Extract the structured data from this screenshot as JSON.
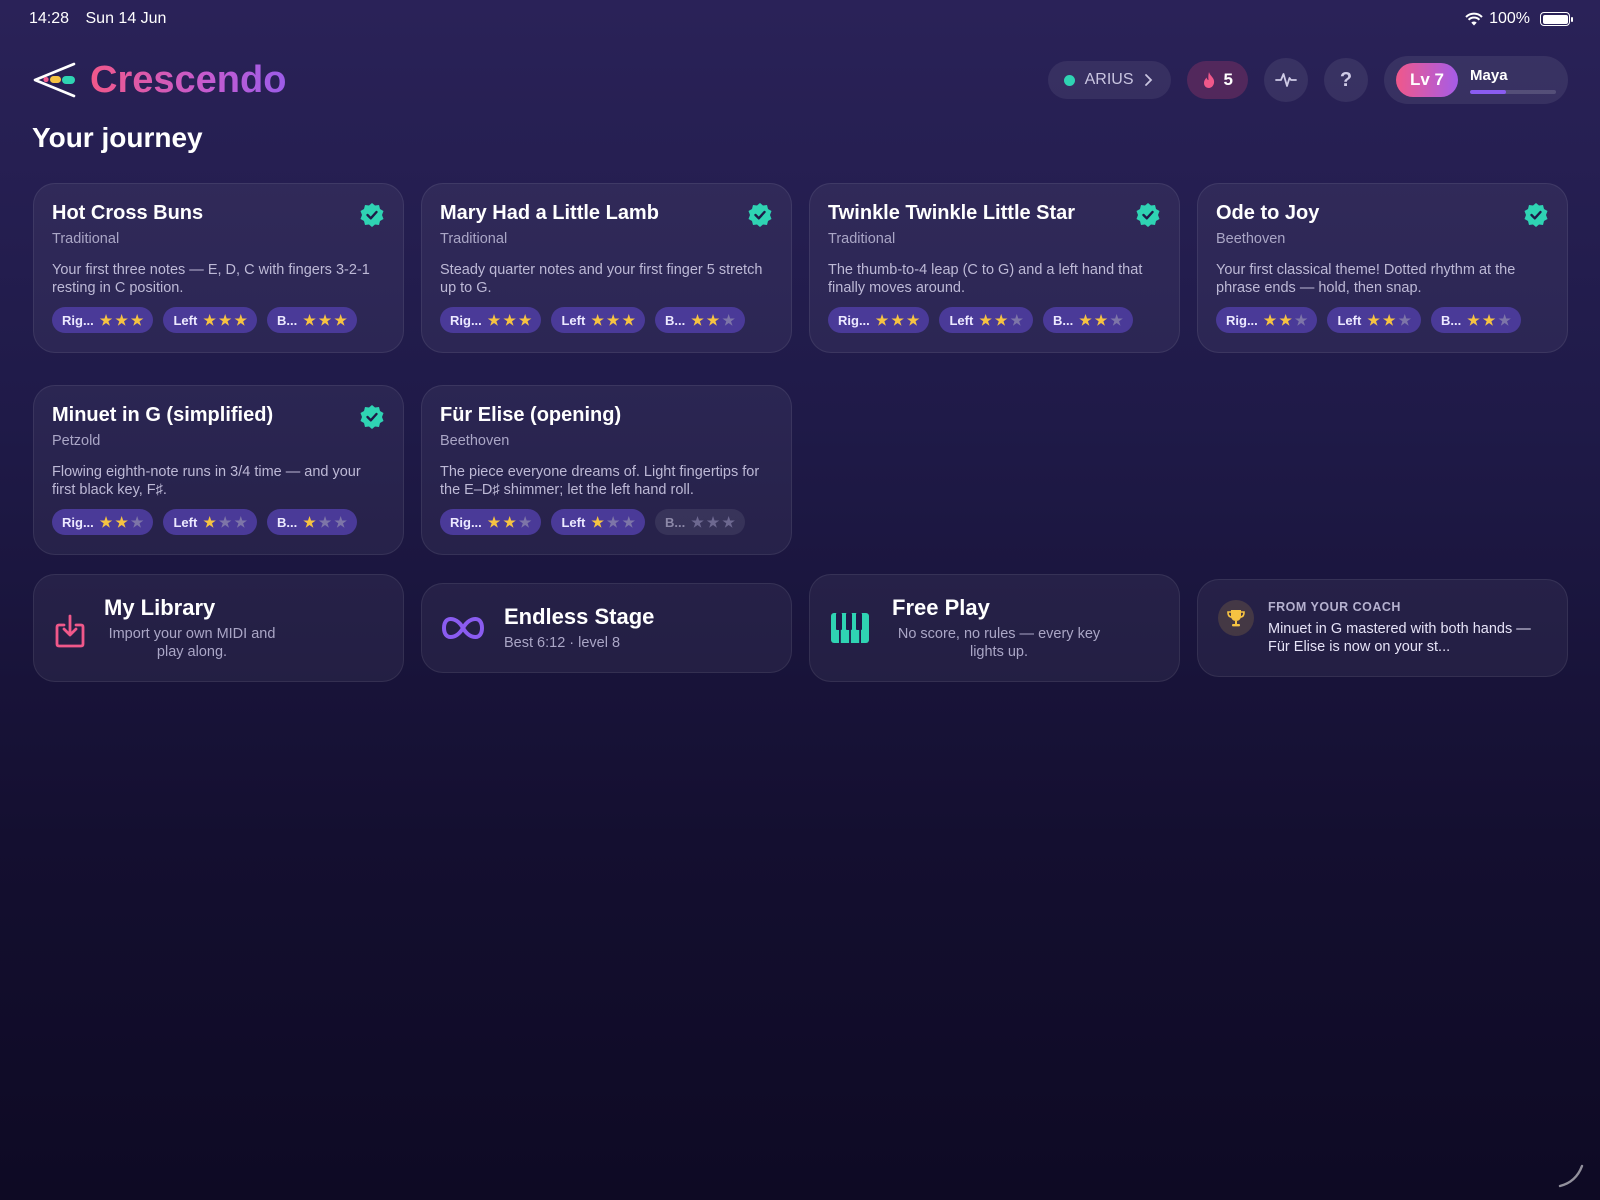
{
  "status_bar": {
    "time": "14:28",
    "date": "Sun 14 Jun",
    "battery": "100%"
  },
  "app": {
    "name": "Crescendo"
  },
  "header": {
    "device_label": "ARIUS",
    "streak_count": "5",
    "help_label": "?",
    "profile": {
      "level": "Lv 7",
      "name": "Maya",
      "xp_progress": 0.42
    }
  },
  "section_title": "Your journey",
  "songs": [
    {
      "title": "Hot Cross Buns",
      "composer": "Traditional",
      "description": "Your first three notes — E, D, C with fingers 3-2-1 resting in C position.",
      "completed": true,
      "hands": [
        {
          "label": "Rig...",
          "stars": 3,
          "locked": false
        },
        {
          "label": "Left",
          "stars": 3,
          "locked": false
        },
        {
          "label": "B...",
          "stars": 3,
          "locked": false
        }
      ]
    },
    {
      "title": "Mary Had a Little Lamb",
      "composer": "Traditional",
      "description": "Steady quarter notes and your first finger 5 stretch up to G.",
      "completed": true,
      "hands": [
        {
          "label": "Rig...",
          "stars": 3,
          "locked": false
        },
        {
          "label": "Left",
          "stars": 3,
          "locked": false
        },
        {
          "label": "B...",
          "stars": 2,
          "locked": false
        }
      ]
    },
    {
      "title": "Twinkle Twinkle Little Star",
      "composer": "Traditional",
      "description": "The thumb-to-4 leap (C to G) and a left hand that finally moves around.",
      "completed": true,
      "hands": [
        {
          "label": "Rig...",
          "stars": 3,
          "locked": false
        },
        {
          "label": "Left",
          "stars": 2,
          "locked": false
        },
        {
          "label": "B...",
          "stars": 2,
          "locked": false
        }
      ]
    },
    {
      "title": "Ode to Joy",
      "composer": "Beethoven",
      "description": "Your first classical theme! Dotted rhythm at the phrase ends — hold, then snap.",
      "completed": true,
      "hands": [
        {
          "label": "Rig...",
          "stars": 2,
          "locked": false
        },
        {
          "label": "Left",
          "stars": 2,
          "locked": false
        },
        {
          "label": "B...",
          "stars": 2,
          "locked": false
        }
      ]
    },
    {
      "title": "Minuet in G (simplified)",
      "composer": "Petzold",
      "description": "Flowing eighth-note runs in 3/4 time — and your first black key, F♯.",
      "completed": true,
      "hands": [
        {
          "label": "Rig...",
          "stars": 2,
          "locked": false
        },
        {
          "label": "Left",
          "stars": 1,
          "locked": false
        },
        {
          "label": "B...",
          "stars": 1,
          "locked": false
        }
      ]
    },
    {
      "title": "Für Elise (opening)",
      "composer": "Beethoven",
      "description": "The piece everyone dreams of. Light fingertips for the E–D♯ shimmer; let the left hand roll.",
      "completed": false,
      "hands": [
        {
          "label": "Rig...",
          "stars": 2,
          "locked": false
        },
        {
          "label": "Left",
          "stars": 1,
          "locked": false
        },
        {
          "label": "B...",
          "stars": 0,
          "locked": true
        }
      ]
    }
  ],
  "features": {
    "library": {
      "title": "My Library",
      "subtitle": "Import your own MIDI and play along."
    },
    "endless": {
      "title": "Endless Stage",
      "subtitle": "Best 6:12 · level 8"
    },
    "free_play": {
      "title": "Free Play",
      "subtitle": "No score, no rules — every key lights up."
    },
    "coach": {
      "label": "FROM YOUR COACH",
      "message": "Minuet in G mastered with both hands — Für Elise is now on your st..."
    }
  },
  "colors": {
    "accent_teal": "#2fd3b3",
    "accent_pink": "#f0588a",
    "accent_purple": "#8a5cf0",
    "star": "#f6c342"
  }
}
